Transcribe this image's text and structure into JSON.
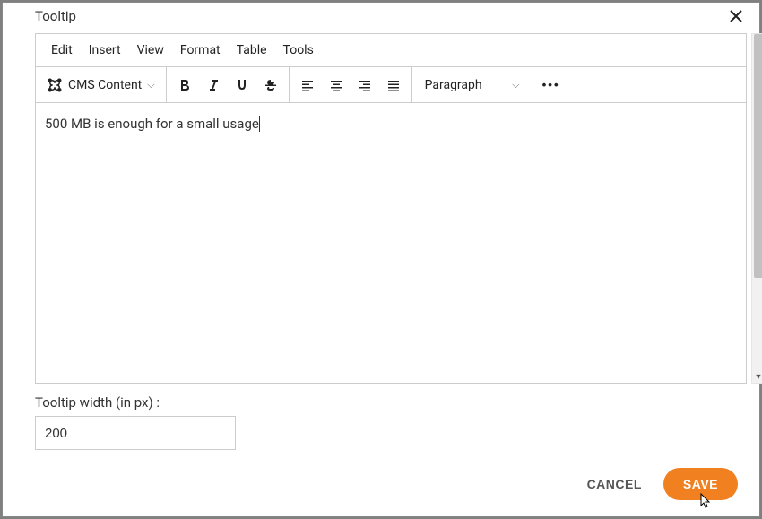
{
  "modal": {
    "title": "Tooltip"
  },
  "editor": {
    "menubar": [
      "Edit",
      "Insert",
      "View",
      "Format",
      "Table",
      "Tools"
    ],
    "cms_label": "CMS Content",
    "format_select": "Paragraph",
    "content": "500 MB is enough for a small usage"
  },
  "tooltip_width": {
    "label": "Tooltip width (in px) :",
    "value": "200"
  },
  "actions": {
    "cancel": "CANCEL",
    "save": "SAVE"
  }
}
